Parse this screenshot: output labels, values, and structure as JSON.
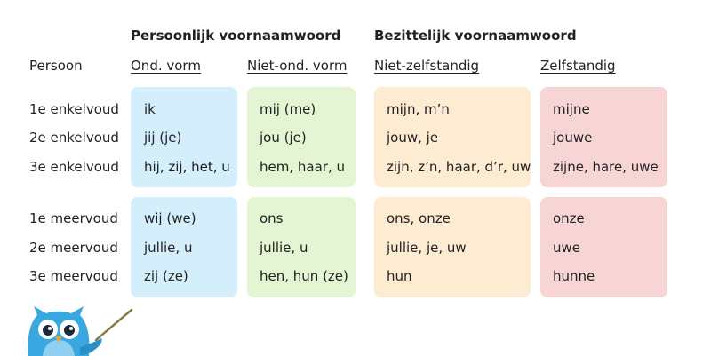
{
  "headers": {
    "group_personal": "Persoonlijk voornaamwoord",
    "group_possessive": "Bezittelijk voornaamwoord",
    "persoon": "Persoon",
    "columns": [
      "Ond. vorm",
      "Niet-ond. vorm",
      "Niet-zelfstandig",
      "Zelfstandig"
    ]
  },
  "rows": [
    {
      "label": "1e enkelvoud",
      "cells": [
        "ik",
        "mij (me)",
        "mijn, m’n",
        "mijne"
      ]
    },
    {
      "label": "2e enkelvoud",
      "cells": [
        "jij (je)",
        "jou (je)",
        "jouw, je",
        "jouwe"
      ]
    },
    {
      "label": "3e enkelvoud",
      "cells": [
        "hij, zij, het, u",
        "hem, haar, u",
        "zijn, z’n, haar, d’r, uw",
        "zijne, hare, uwe"
      ]
    },
    {
      "label": "1e meervoud",
      "cells": [
        "wij (we)",
        "ons",
        "ons, onze",
        "onze"
      ]
    },
    {
      "label": "2e meervoud",
      "cells": [
        "jullie, u",
        "jullie, u",
        "jullie, je, uw",
        "uwe"
      ]
    },
    {
      "label": "3e meervoud",
      "cells": [
        "zij (ze)",
        "hen, hun (ze)",
        "hun",
        "hunne"
      ]
    }
  ],
  "colors": {
    "col1": "#d4eefb",
    "col2": "#e3f5d2",
    "col3": "#fdebd2",
    "col4": "#f7d5d5",
    "owl_blue": "#3aa8e0"
  },
  "icons": {
    "mascot": "owl-mascot-icon"
  }
}
